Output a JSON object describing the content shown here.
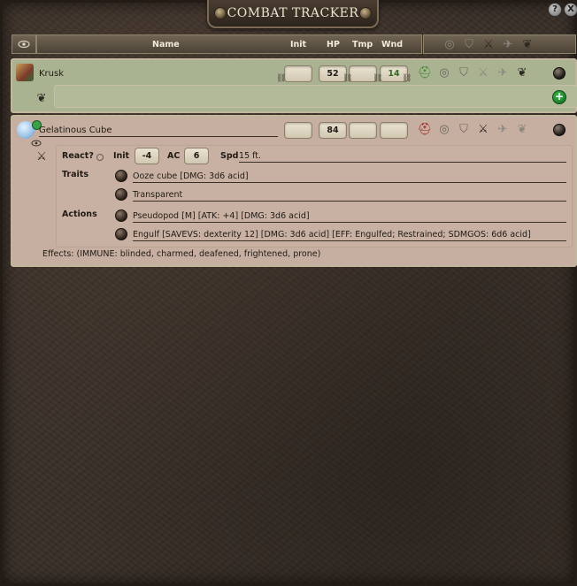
{
  "window": {
    "title": "COMBAT TRACKER",
    "help_label": "?",
    "close_label": "X"
  },
  "header": {
    "name": "Name",
    "init": "Init",
    "hp": "HP",
    "tmp": "Tmp",
    "wnd": "Wnd"
  },
  "combatants": [
    {
      "name": "Krusk",
      "init": "",
      "hp": "52",
      "tmp": "",
      "wnd": "14",
      "faction": "friend",
      "add_effect_label": "+"
    },
    {
      "name": "Gelatinous Cube",
      "init": "",
      "hp": "84",
      "tmp": "",
      "wnd": "",
      "faction": "foe",
      "details": {
        "react_label": "React?",
        "init_label": "Init",
        "init_value": "-4",
        "ac_label": "AC",
        "ac_value": "6",
        "spd_label": "Spd",
        "spd_value": "15 ft.",
        "traits_label": "Traits",
        "traits": [
          "Ooze cube [DMG: 3d6 acid]",
          "Transparent"
        ],
        "actions_label": "Actions",
        "actions": [
          "Pseudopod [M] [ATK: +4] [DMG: 3d6 acid]",
          "Engulf [SAVEVS: dexterity 12] [DMG: 3d6 acid] [EFF: Engulfed; Restrained; SDMGOS: 6d6 acid]"
        ]
      },
      "effects_text": "Effects: (IMMUNE: blinded, charmed, deafened, frightened, prone)"
    }
  ],
  "colors": {
    "friend_bg": "#a9b291",
    "foe_bg": "#c6aea0",
    "wnd_text": "#2f6b22"
  },
  "icons": [
    "visibility-eye-icon",
    "target-icon",
    "shield-icon",
    "sword-icon",
    "wings-icon",
    "dragon-icon"
  ]
}
